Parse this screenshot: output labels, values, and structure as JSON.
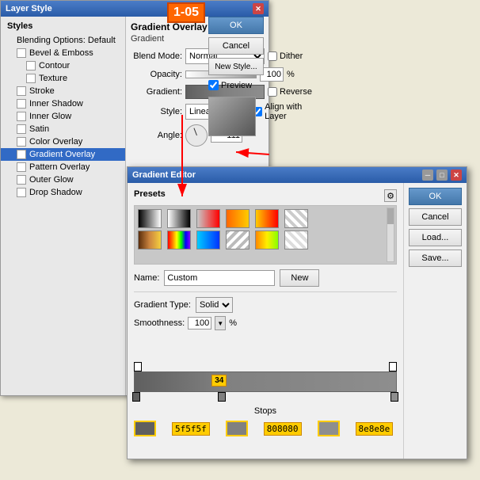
{
  "badge": "1-05",
  "layerStyle": {
    "title": "Layer Style",
    "sidebar": {
      "header": "Styles",
      "items": [
        {
          "id": "blending-options",
          "label": "Blending Options: Default",
          "checked": false,
          "active": false,
          "indent": 0
        },
        {
          "id": "bevel-emboss",
          "label": "Bevel & Emboss",
          "checked": false,
          "active": false,
          "indent": 0
        },
        {
          "id": "contour",
          "label": "Contour",
          "checked": false,
          "active": false,
          "indent": 1
        },
        {
          "id": "texture",
          "label": "Texture",
          "checked": false,
          "active": false,
          "indent": 1
        },
        {
          "id": "stroke",
          "label": "Stroke",
          "checked": false,
          "active": false,
          "indent": 0
        },
        {
          "id": "inner-shadow",
          "label": "Inner Shadow",
          "checked": false,
          "active": false,
          "indent": 0
        },
        {
          "id": "inner-glow",
          "label": "Inner Glow",
          "checked": false,
          "active": false,
          "indent": 0
        },
        {
          "id": "satin",
          "label": "Satin",
          "checked": false,
          "active": false,
          "indent": 0
        },
        {
          "id": "color-overlay",
          "label": "Color Overlay",
          "checked": false,
          "active": false,
          "indent": 0
        },
        {
          "id": "gradient-overlay",
          "label": "Gradient Overlay",
          "checked": true,
          "active": true,
          "indent": 0
        },
        {
          "id": "pattern-overlay",
          "label": "Pattern Overlay",
          "checked": false,
          "active": false,
          "indent": 0
        },
        {
          "id": "outer-glow",
          "label": "Outer Glow",
          "checked": false,
          "active": false,
          "indent": 0
        },
        {
          "id": "drop-shadow",
          "label": "Drop Shadow",
          "checked": false,
          "active": false,
          "indent": 0
        }
      ]
    },
    "buttons": {
      "ok": "OK",
      "cancel": "Cancel",
      "new_style": "New Style...",
      "preview_label": "Preview"
    },
    "gradientOverlay": {
      "title": "Gradient Overlay",
      "subtitle": "Gradient",
      "blendMode": {
        "label": "Blend Mode:",
        "value": "Normal"
      },
      "dither": {
        "label": "Dither",
        "checked": false
      },
      "opacity": {
        "label": "Opacity:",
        "value": "100",
        "unit": "%"
      },
      "gradient": {
        "label": "Gradient:"
      },
      "reverse": {
        "label": "Reverse",
        "checked": false
      },
      "style": {
        "label": "Style:",
        "value": "Linear"
      },
      "alignWithLayer": {
        "label": "Align with Layer",
        "checked": true
      },
      "angle": {
        "label": "Angle:",
        "value": "-111",
        "unit": "°"
      }
    }
  },
  "gradientEditor": {
    "title": "Gradient Editor",
    "presetsLabel": "Presets",
    "nameLabel": "Name:",
    "nameValue": "Custom",
    "newButton": "New",
    "gradientTypeLabel": "Gradient Type:",
    "gradientTypeValue": "Solid",
    "smoothnessLabel": "Smoothness:",
    "smoothnessValue": "100",
    "smoothnessUnit": "%",
    "stopsLabel": "Stops",
    "buttons": {
      "ok": "OK",
      "cancel": "Cancel",
      "load": "Load...",
      "save": "Save..."
    },
    "stopMarkerValue": "34",
    "stops": [
      {
        "id": "stop1",
        "color": "#5f5f5f",
        "label": "5f5f5f",
        "position": 0
      },
      {
        "id": "stop2",
        "color": "#808080",
        "label": "808080",
        "position": 34
      },
      {
        "id": "stop3",
        "color": "#8e8e8e",
        "label": "8e8e8e",
        "position": 100
      }
    ],
    "presets": [
      {
        "id": "p1",
        "gradient": "linear-gradient(to right, #000, #fff)"
      },
      {
        "id": "p2",
        "gradient": "linear-gradient(to right, #fff, #000)"
      },
      {
        "id": "p3",
        "gradient": "linear-gradient(to right, rgba(0,0,0,0), #000)"
      },
      {
        "id": "p4",
        "gradient": "linear-gradient(to right, #ff0000, #ffff00, #00ff00)"
      },
      {
        "id": "p5",
        "gradient": "linear-gradient(to right, #ff8800, #ffff00)"
      },
      {
        "id": "p6",
        "gradient": "linear-gradient(45deg, #ccc 25%, transparent 25%, transparent 75%, #ccc 75%)"
      },
      {
        "id": "p7",
        "gradient": "linear-gradient(to right, #8b4513, #cd853f, #f4a460)"
      },
      {
        "id": "p8",
        "gradient": "linear-gradient(to right, #ff0000, #ff7700, #ffff00, #00ff00, #0000ff, #8800ff)"
      },
      {
        "id": "p9",
        "gradient": "linear-gradient(to right, #00ccff, #0044ff)"
      },
      {
        "id": "p10",
        "gradient": "linear-gradient(45deg, #aaa 25%, #eee 25%, #eee 75%, #aaa 75%)"
      },
      {
        "id": "p11",
        "gradient": "linear-gradient(to right, #333, #666, #999)"
      },
      {
        "id": "p12",
        "gradient": "linear-gradient(to right, #ffaa00, #ff4400)"
      }
    ]
  }
}
